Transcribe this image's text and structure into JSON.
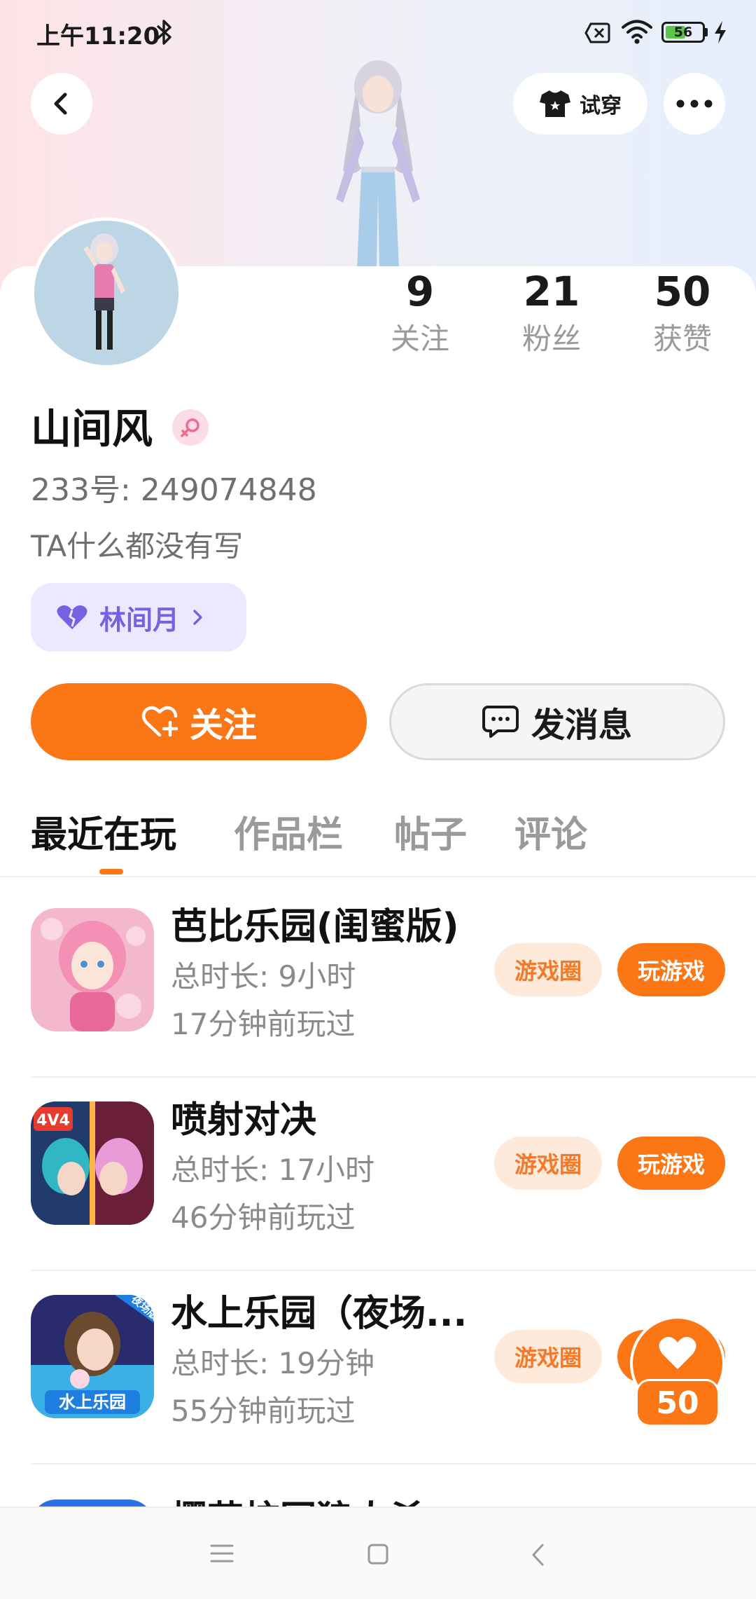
{
  "status_bar": {
    "time": "上午11:20",
    "battery": "56",
    "battery_level": 0.56
  },
  "header": {
    "try_on_label": "试穿"
  },
  "stats": [
    {
      "value": "9",
      "label": "关注"
    },
    {
      "value": "21",
      "label": "粉丝"
    },
    {
      "value": "50",
      "label": "获赞"
    }
  ],
  "profile": {
    "name": "山间风",
    "id_text": "233号: 249074848",
    "bio": "TA什么都没有写",
    "cp_name": "林间月"
  },
  "actions": {
    "follow_label": "关注",
    "message_label": "发消息"
  },
  "tabs": [
    "最近在玩",
    "作品栏",
    "帖子",
    "评论"
  ],
  "games": [
    {
      "title": "芭比乐园(闺蜜版)",
      "duration": "总时长: 9小时",
      "last_played": "17分钟前玩过",
      "circle_label": "游戏圈",
      "play_label": "玩游戏"
    },
    {
      "title": "喷射对决",
      "duration": "总时长: 17小时",
      "last_played": "46分钟前玩过",
      "circle_label": "游戏圈",
      "play_label": "玩游戏",
      "icon_badge": "4V4"
    },
    {
      "title": "水上乐园（夜场...",
      "duration": "总时长: 19分钟",
      "last_played": "55分钟前玩过",
      "circle_label": "游戏圈",
      "play_label": "玩游戏",
      "icon_badge": "夜场版",
      "icon_text": "水上乐园"
    },
    {
      "title": "樱花校园狼人杀",
      "duration": "",
      "last_played": "",
      "circle_label": "",
      "play_label": ""
    }
  ],
  "like_fab": {
    "count": "50"
  }
}
